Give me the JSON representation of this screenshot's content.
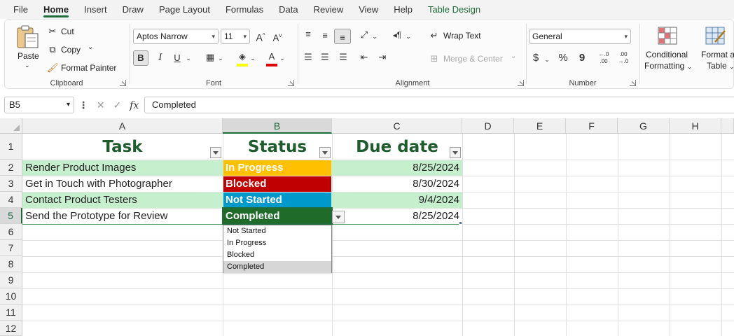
{
  "menu": {
    "tabs": [
      "File",
      "Home",
      "Insert",
      "Draw",
      "Page Layout",
      "Formulas",
      "Data",
      "Review",
      "View",
      "Help",
      "Table Design"
    ],
    "active": "Home"
  },
  "ribbon": {
    "clipboard": {
      "label": "Clipboard",
      "paste": "Paste",
      "cut": "Cut",
      "copy": "Copy",
      "format_painter": "Format Painter"
    },
    "font": {
      "label": "Font",
      "family": "Aptos Narrow",
      "size": "11",
      "bold": "B",
      "italic": "I",
      "underline": "U",
      "grow": "A",
      "shrink": "A",
      "font_color": "A"
    },
    "alignment": {
      "label": "Alignment",
      "wrap_text": "Wrap Text",
      "merge_center": "Merge & Center"
    },
    "number": {
      "label": "Number",
      "format": "General",
      "currency": "$",
      "percent": "%",
      "comma": "9",
      "inc_decimal": "←.0 .00",
      "dec_decimal": ".00 →.0"
    },
    "styles": {
      "conditional_formatting_1": "Conditional",
      "conditional_formatting_2": "Formatting",
      "format_as_table_1": "Format as",
      "format_as_table_2": "Table"
    }
  },
  "formula_bar": {
    "name_box": "B5",
    "fx": "fx",
    "content": "Completed"
  },
  "grid": {
    "columns": [
      "A",
      "B",
      "C",
      "D",
      "E",
      "F",
      "G",
      "H"
    ],
    "rows": [
      "1",
      "2",
      "3",
      "4",
      "5",
      "6",
      "7",
      "8",
      "9",
      "10",
      "11",
      "12"
    ],
    "headers": {
      "task": "Task",
      "status": "Status",
      "due": "Due date"
    },
    "data": [
      {
        "task": "Render Product Images",
        "status": "In Progress",
        "due": "8/25/2024",
        "status_color": "#ffc000"
      },
      {
        "task": "Get in Touch with Photographer",
        "status": "Blocked",
        "due": "8/30/2024",
        "status_color": "#c00000"
      },
      {
        "task": "Contact Product Testers",
        "status": "Not Started",
        "due": "9/4/2024",
        "status_color": "#0099cc"
      },
      {
        "task": "Send the Prototype for Review",
        "status": "Completed",
        "due": "8/25/2024",
        "status_color": "#1e6b2a"
      }
    ],
    "band_color": "#c6efce",
    "header_color": "#1e5c2e"
  },
  "dropdown": {
    "options": [
      "Not Started",
      "In Progress",
      "Blocked",
      "Completed"
    ],
    "selected": "Completed"
  },
  "colors": {
    "accent": "#1e6b3c"
  }
}
